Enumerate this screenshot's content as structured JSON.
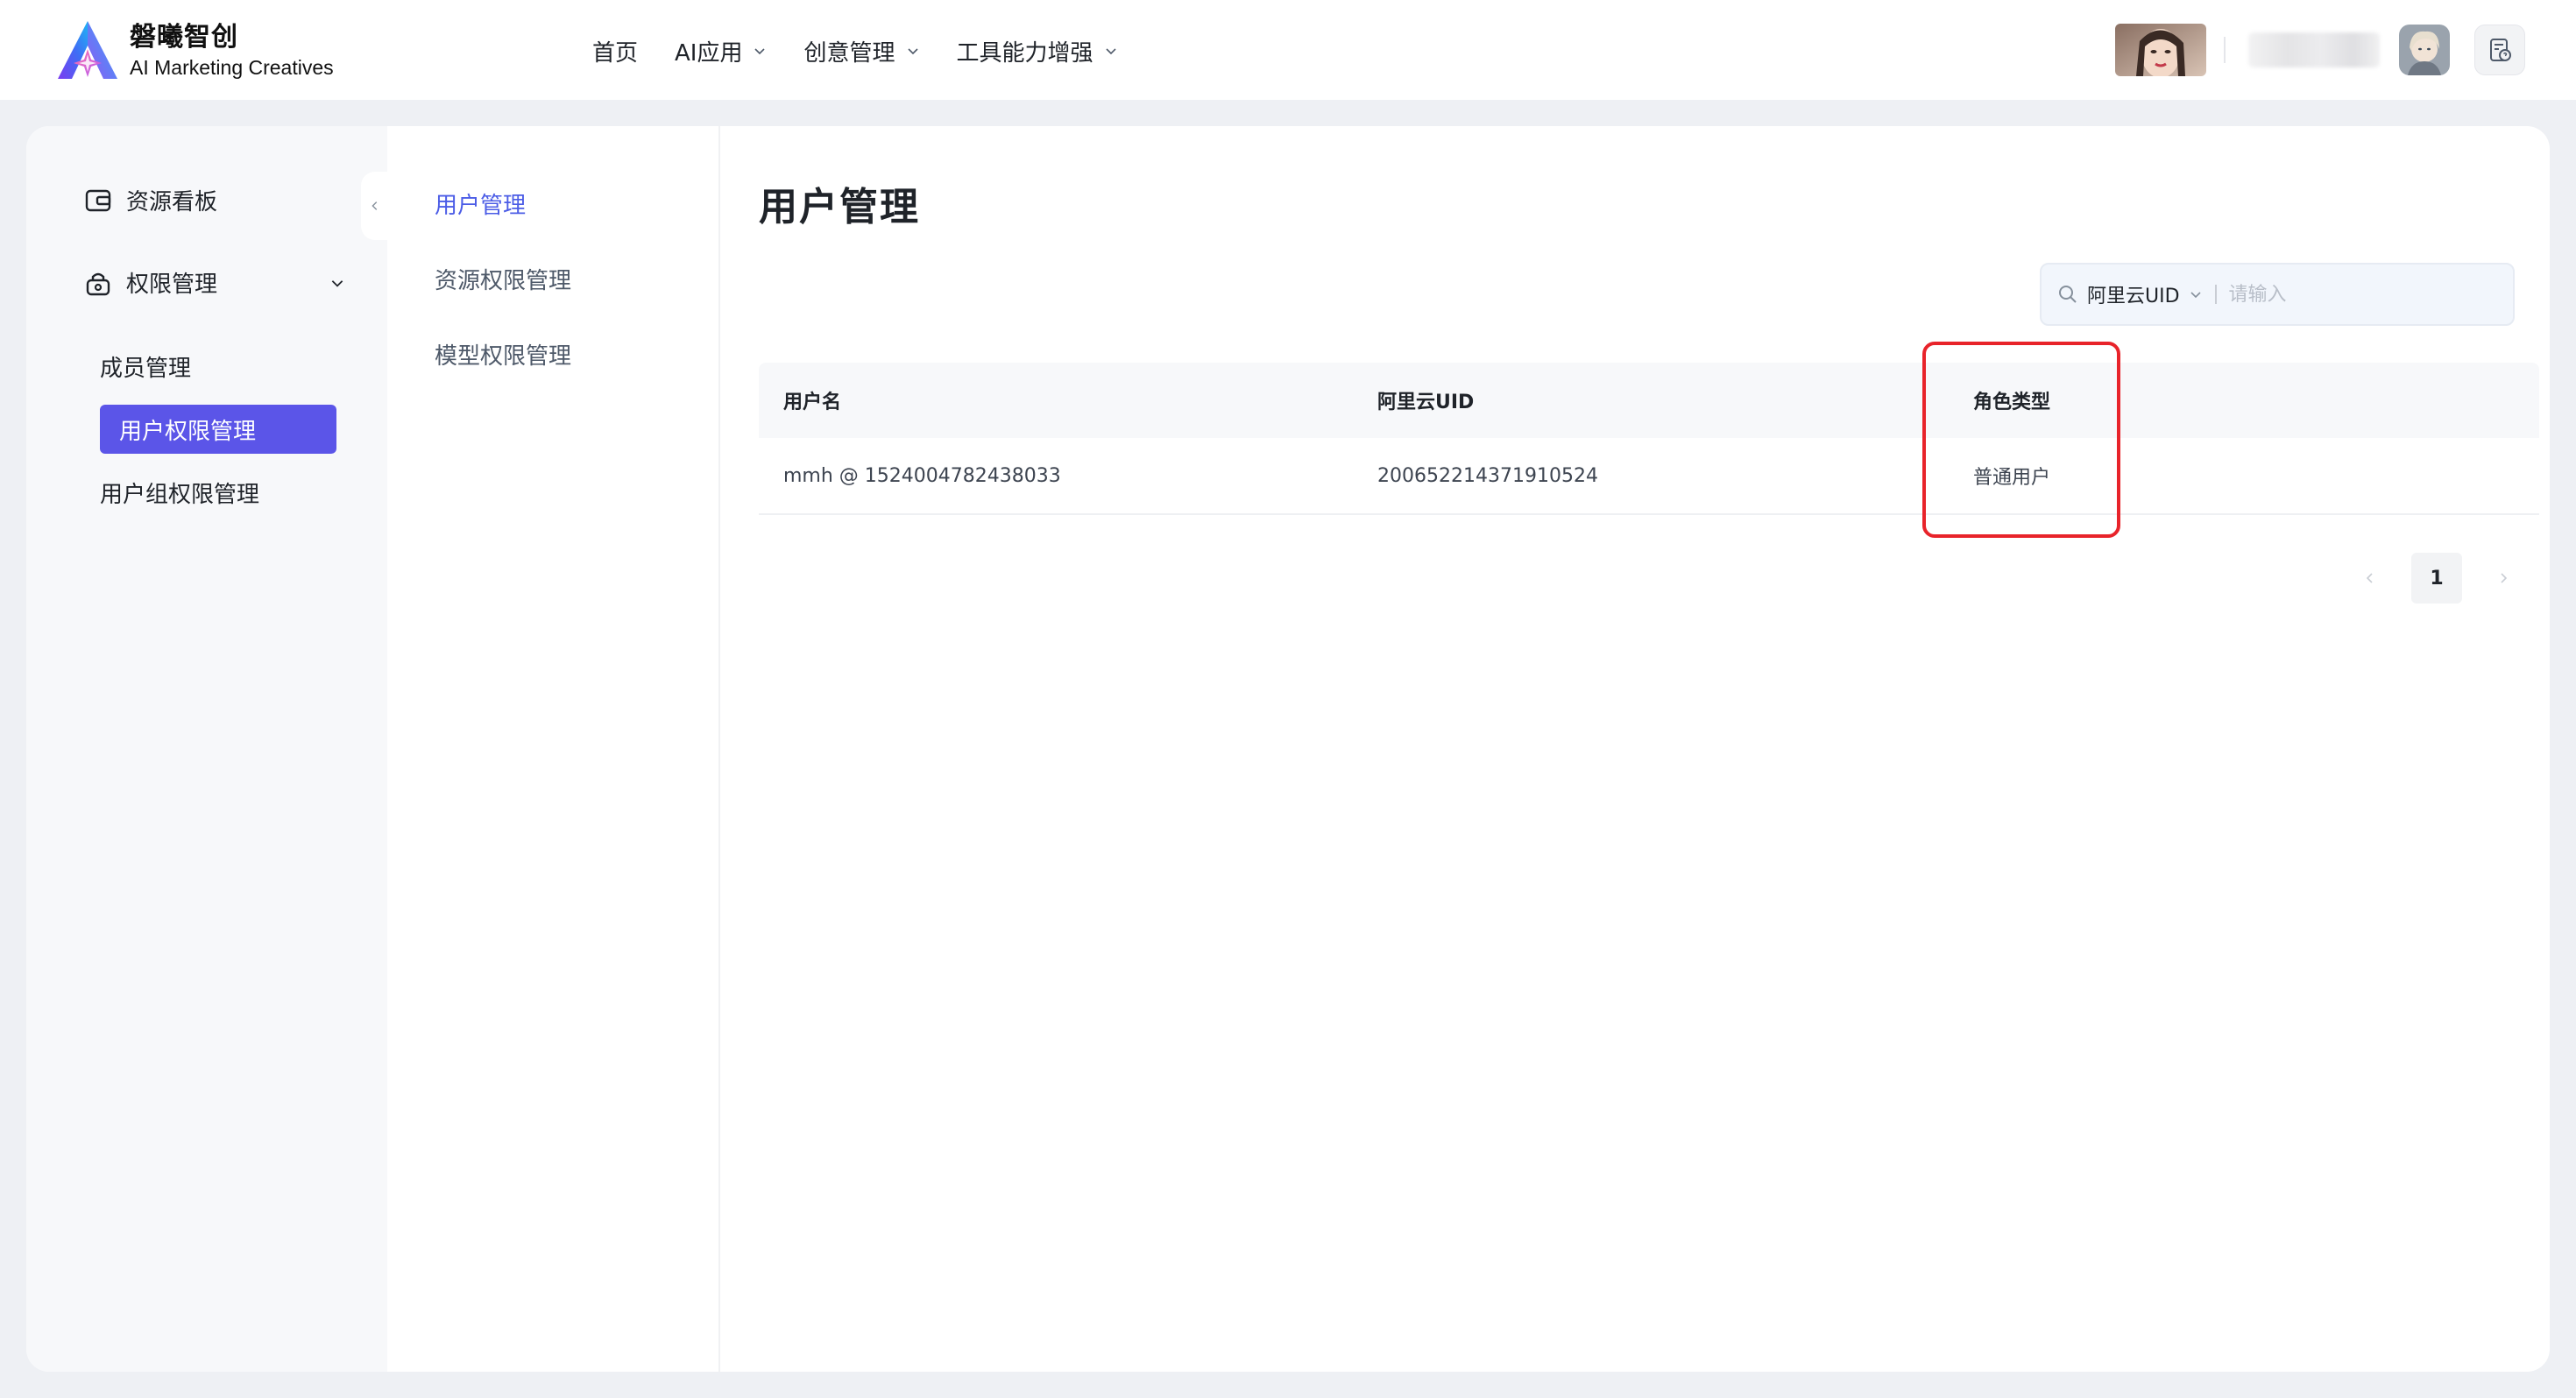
{
  "brand": {
    "name_cn": "磐曦智创",
    "name_en": "AI Marketing Creatives"
  },
  "top_nav": {
    "items": [
      {
        "label": "首页",
        "has_dropdown": false
      },
      {
        "label": "AI应用",
        "has_dropdown": true
      },
      {
        "label": "创意管理",
        "has_dropdown": true
      },
      {
        "label": "工具能力增强",
        "has_dropdown": true
      }
    ]
  },
  "sidebar": {
    "items": [
      {
        "label": "资源看板",
        "icon": "dashboard-icon"
      },
      {
        "label": "权限管理",
        "icon": "lock-icon",
        "expanded": true,
        "children": [
          "成员管理",
          "用户权限管理",
          "用户组权限管理"
        ],
        "active_child": "用户权限管理"
      }
    ]
  },
  "subnav": {
    "items": [
      "用户管理",
      "资源权限管理",
      "模型权限管理"
    ],
    "active": "用户管理"
  },
  "page": {
    "title": "用户管理"
  },
  "search": {
    "field_label": "阿里云UID",
    "placeholder": "请输入"
  },
  "table": {
    "columns": [
      "用户名",
      "阿里云UID",
      "角色类型"
    ],
    "rows": [
      [
        "mmh @ 1524004782438033",
        "200652214371910524",
        "普通用户"
      ]
    ]
  },
  "pagination": {
    "current_page": "1"
  },
  "colors": {
    "accent": "#5b55e8",
    "link": "#4b5ce6",
    "highlight_box": "#e8232a"
  }
}
